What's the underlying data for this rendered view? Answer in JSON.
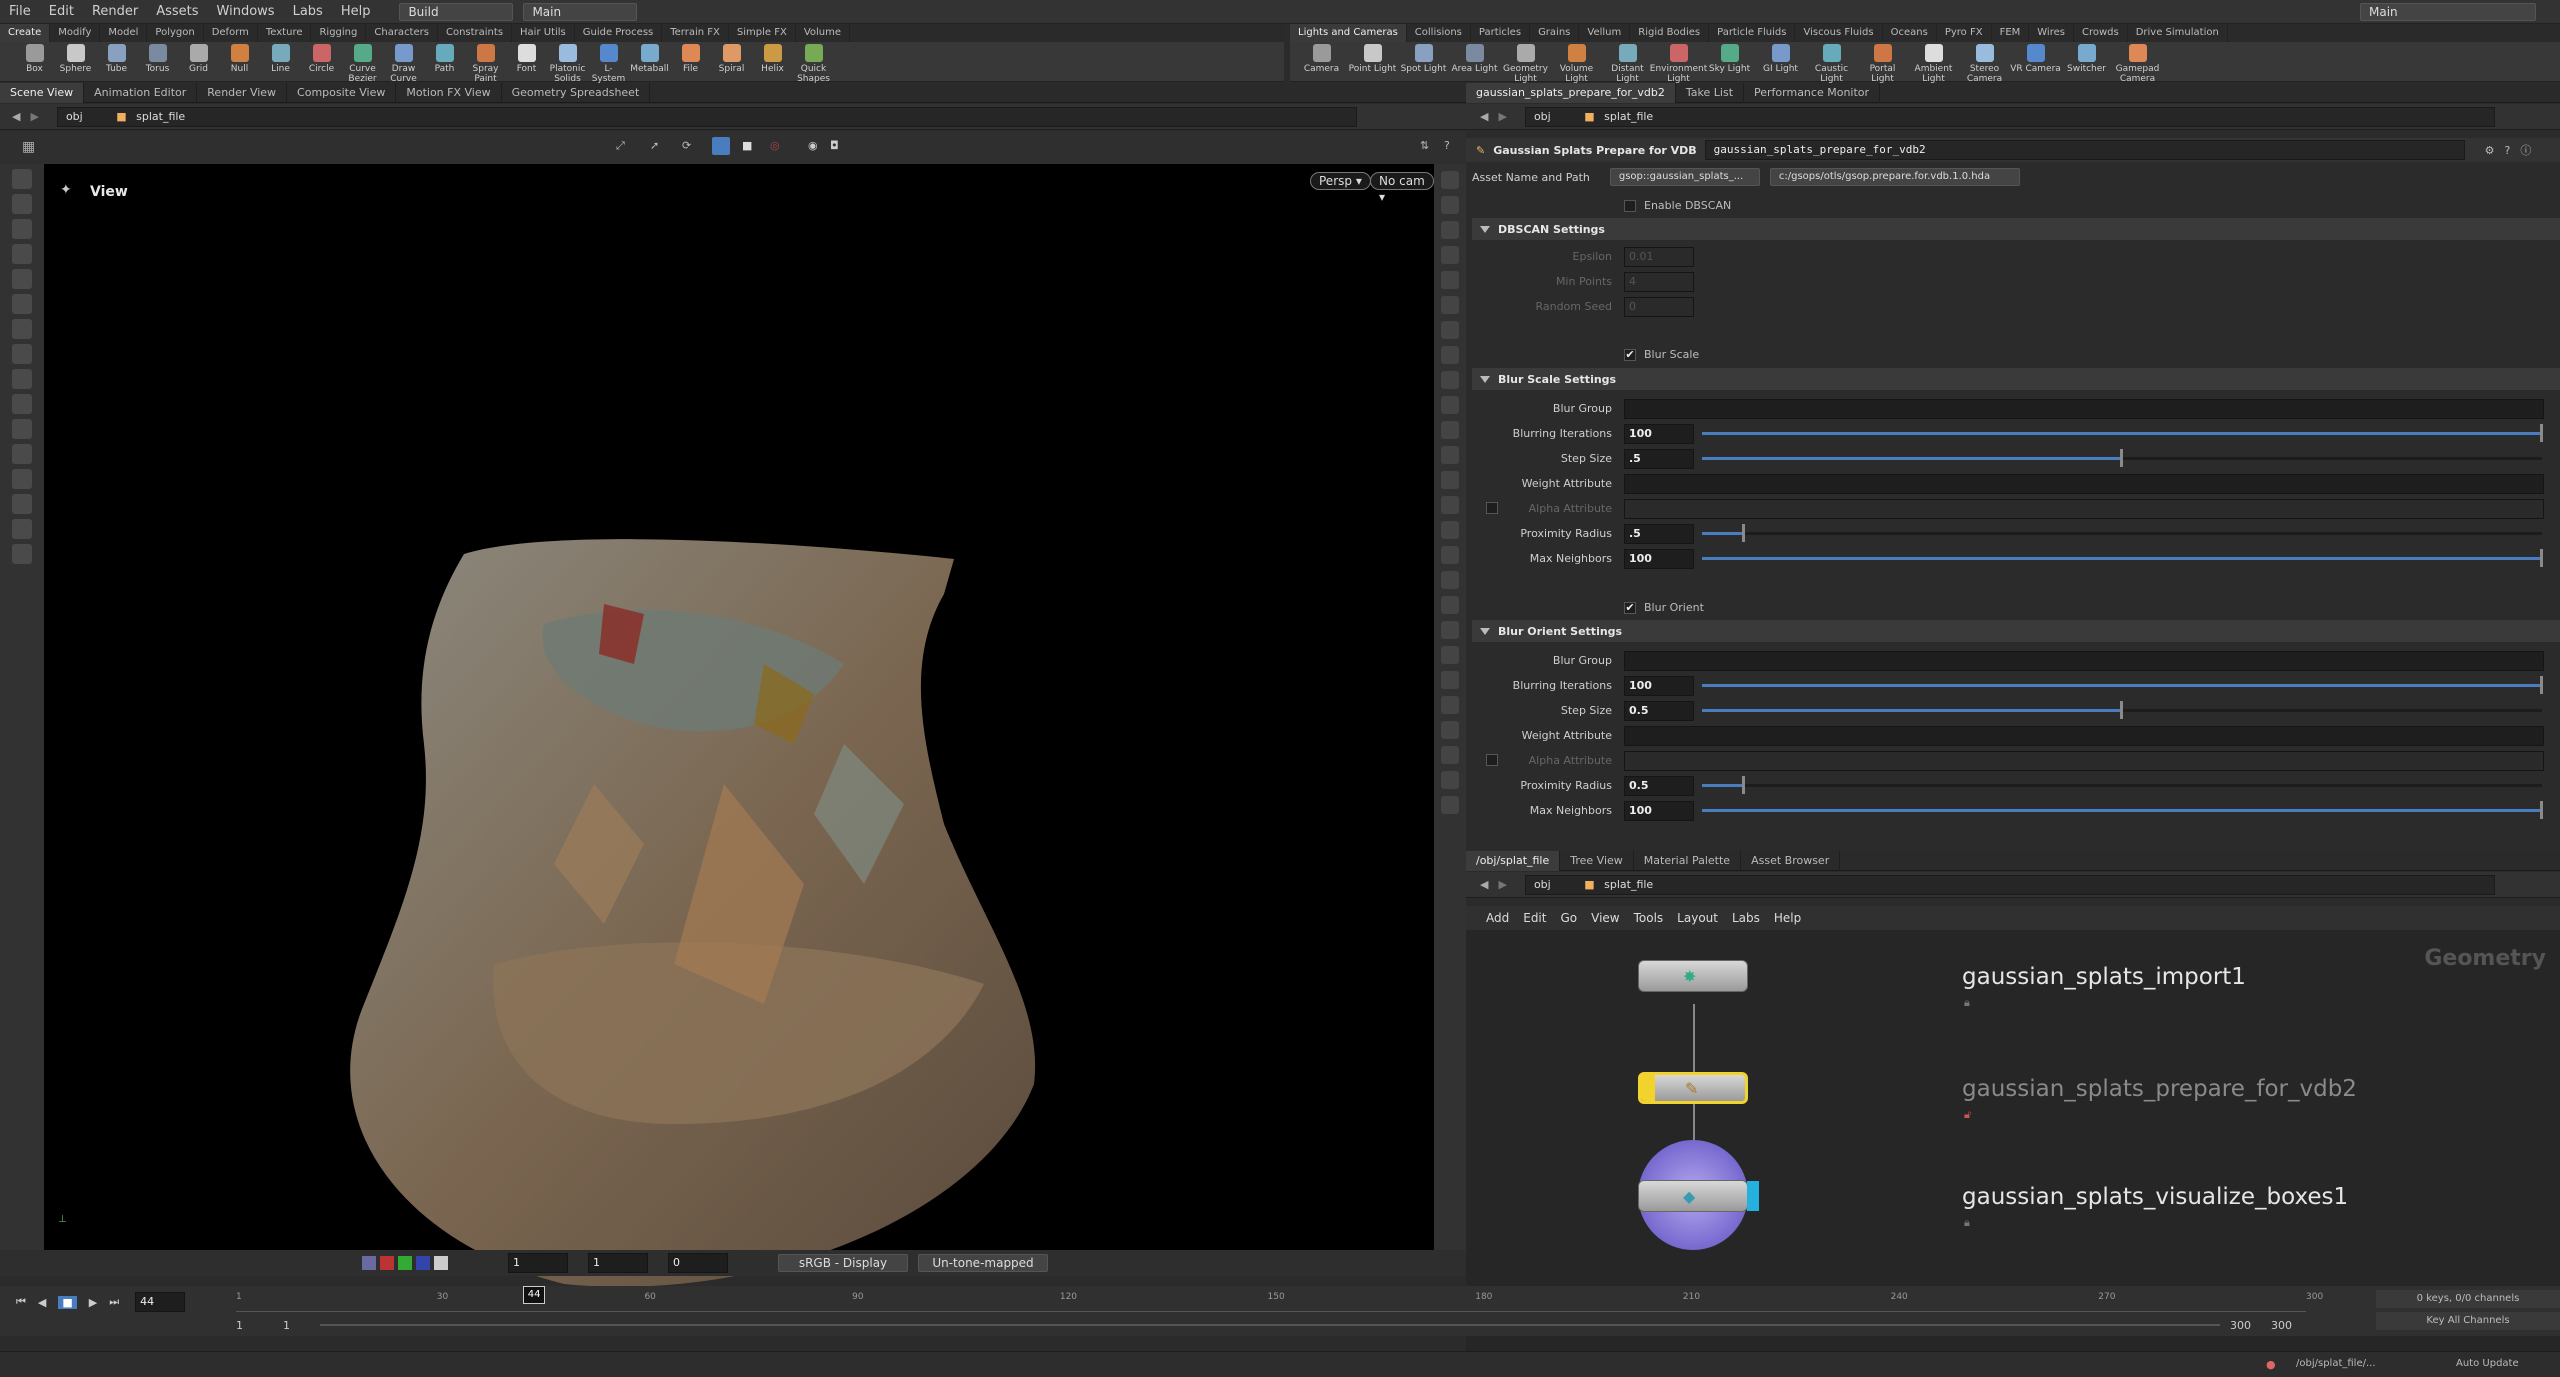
{
  "menubar": {
    "items": [
      "File",
      "Edit",
      "Render",
      "Assets",
      "Windows",
      "Labs",
      "Help"
    ],
    "desktop": "Build",
    "context": "Main",
    "right_desktop": "Main"
  },
  "shelf_left": {
    "tabs": [
      "Create",
      "Modify",
      "Model",
      "Polygon",
      "Deform",
      "Texture",
      "Rigging",
      "Characters",
      "Constraints",
      "Hair Utils",
      "Guide Process",
      "Terrain FX",
      "Simple FX",
      "Volume"
    ],
    "tools": [
      "Box",
      "Sphere",
      "Tube",
      "Torus",
      "Grid",
      "Null",
      "Line",
      "Circle",
      "Curve Bezier",
      "Draw Curve",
      "Path",
      "Spray Paint",
      "Font",
      "Platonic Solids",
      "L-System",
      "Metaball",
      "File",
      "Spiral",
      "Helix",
      "Quick Shapes"
    ]
  },
  "shelf_right": {
    "tabs": [
      "Lights and Cameras",
      "Collisions",
      "Particles",
      "Grains",
      "Vellum",
      "Rigid Bodies",
      "Particle Fluids",
      "Viscous Fluids",
      "Oceans",
      "Pyro FX",
      "FEM",
      "Wires",
      "Crowds",
      "Drive Simulation"
    ],
    "tools": [
      "Camera",
      "Point Light",
      "Spot Light",
      "Area Light",
      "Geometry Light",
      "Volume Light",
      "Distant Light",
      "Environment Light",
      "Sky Light",
      "GI Light",
      "Caustic Light",
      "Portal Light",
      "Ambient Light",
      "Stereo Camera",
      "VR Camera",
      "Switcher",
      "Gamepad Camera"
    ]
  },
  "left_pane": {
    "tabs": [
      "Scene View",
      "Animation Editor",
      "Render View",
      "Composite View",
      "Motion FX View",
      "Geometry Spreadsheet"
    ],
    "path_root": "obj",
    "path_node": "splat_file",
    "viewport_label": "View",
    "persp": "Persp",
    "cam": "No cam"
  },
  "viewport_bottom": {
    "frame_a": "1",
    "frame_b": "1",
    "frame_c": "0",
    "colorspace": "sRGB - Display",
    "tonemap": "Un-tone-mapped"
  },
  "param_pane": {
    "tabs": [
      "gaussian_splats_prepare_for_vdb2",
      "Take List",
      "Performance Monitor"
    ],
    "path_root": "obj",
    "path_node": "splat_file",
    "node_type": "Gaussian Splats Prepare for VDB",
    "node_name": "gaussian_splats_prepare_for_vdb2",
    "asset_label": "Asset Name and Path",
    "asset_name": "gsop::gaussian_splats_...",
    "asset_path": "c:/gsops/otls/gsop.prepare.for.vdb.1.0.hda",
    "enable_dbscan": "Enable DBSCAN",
    "dbscan_section": "DBSCAN Settings",
    "epsilon_label": "Epsilon",
    "epsilon": "0.01",
    "minpoints_label": "Min Points",
    "minpoints": "4",
    "seed_label": "Random Seed",
    "seed": "0",
    "blur_scale": "Blur Scale",
    "blur_scale_section": "Blur Scale Settings",
    "blur_orient": "Blur Orient",
    "blur_orient_section": "Blur Orient Settings",
    "labels": {
      "blur_group": "Blur Group",
      "iterations": "Blurring Iterations",
      "step": "Step Size",
      "weight": "Weight Attribute",
      "alpha": "Alpha Attribute",
      "radius": "Proximity Radius",
      "neighbors": "Max Neighbors"
    },
    "scale_values": {
      "iterations": "100",
      "step": ".5",
      "radius": ".5",
      "neighbors": "100"
    },
    "orient_values": {
      "iterations": "100",
      "step": "0.5",
      "radius": "0.5",
      "neighbors": "100"
    },
    "scale_levels": {
      "iterations": 1.0,
      "step": 0.5,
      "radius": 0.05,
      "neighbors": 1.0
    },
    "orient_levels": {
      "iterations": 1.0,
      "step": 0.5,
      "radius": 0.05,
      "neighbors": 1.0
    }
  },
  "network_pane": {
    "tabs": [
      "/obj/splat_file",
      "Tree View",
      "Material Palette",
      "Asset Browser"
    ],
    "path_root": "obj",
    "path_node": "splat_file",
    "menu": [
      "Add",
      "Edit",
      "Go",
      "View",
      "Tools",
      "Layout",
      "Labs",
      "Help"
    ],
    "context_label": "Geometry",
    "nodes": [
      "gaussian_splats_import1",
      "gaussian_splats_prepare_for_vdb2",
      "gaussian_splats_visualize_boxes1"
    ]
  },
  "timeline": {
    "current_frame": "44",
    "ticks": [
      "1",
      "30",
      "60",
      "90",
      "120",
      "150",
      "180",
      "210",
      "240",
      "270",
      "300"
    ],
    "start": "1",
    "start2": "1",
    "end": "300",
    "end2": "300",
    "keys": "0 keys, 0/0 channels",
    "key_all": "Key All Channels",
    "playhead_fraction": 0.144
  },
  "status": {
    "path": "/obj/splat_file/...",
    "update": "Auto Update"
  },
  "colors": {
    "accent_blue": "#4a7cc0",
    "node_selected": "#f2d22c",
    "display_flag": "#7a6fd6"
  }
}
